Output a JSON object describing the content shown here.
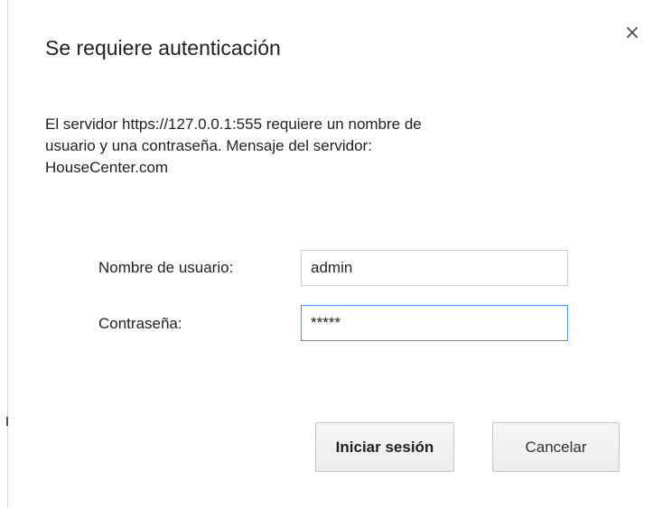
{
  "dialog": {
    "title": "Se requiere autenticación",
    "close_glyph": "×",
    "message_lines": [
      "El servidor https://127.0.0.1:555 requiere un nombre de",
      "usuario y una contraseña. Mensaje del servidor:",
      "HouseCenter.com"
    ]
  },
  "form": {
    "username_label": "Nombre de usuario:",
    "username_value": "admin",
    "password_label": "Contraseña:",
    "password_value": "*****"
  },
  "buttons": {
    "submit_label": "Iniciar sesión",
    "cancel_label": "Cancelar"
  },
  "colors": {
    "focus_border": "#4d90fe",
    "field_border": "#cfcfcf",
    "text": "#222222"
  },
  "icons": {
    "close": "close-icon"
  }
}
